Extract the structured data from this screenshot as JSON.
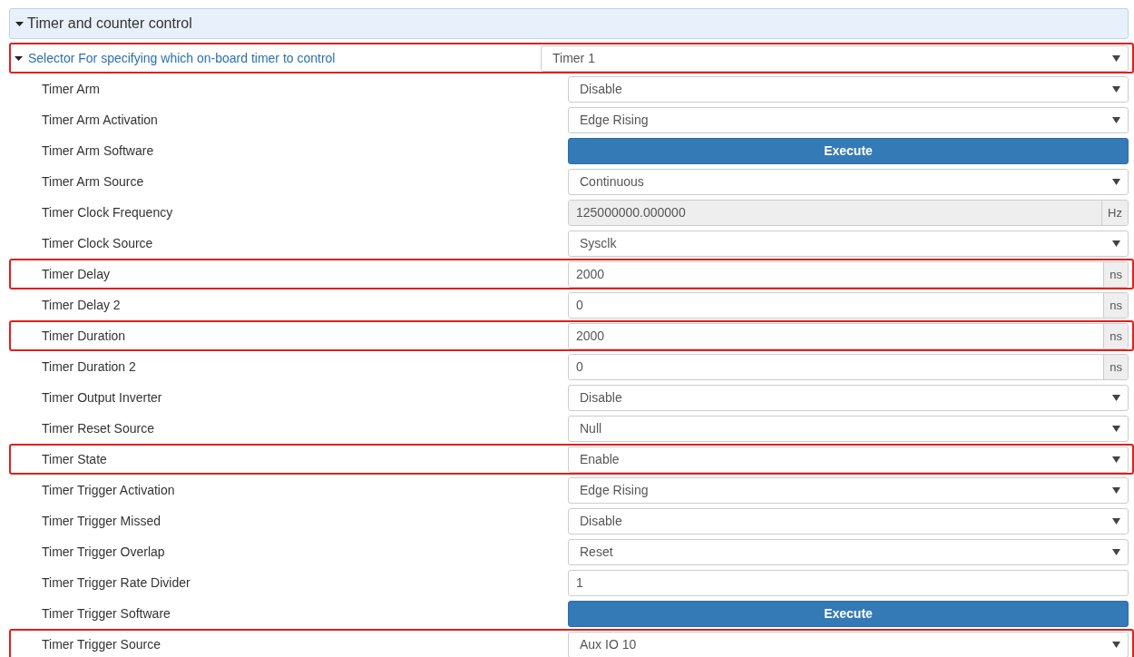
{
  "panel": {
    "title": "Timer and counter control",
    "expanded": true
  },
  "selector": {
    "label": "Selector For specifying which on-board timer to control",
    "expanded": true,
    "value": "Timer 1",
    "highlighted": true
  },
  "rows": [
    {
      "label": "Timer Arm",
      "kind": "select",
      "value": "Disable",
      "highlighted": false
    },
    {
      "label": "Timer Arm Activation",
      "kind": "select",
      "value": "Edge Rising",
      "highlighted": false
    },
    {
      "label": "Timer Arm Software",
      "kind": "button",
      "value": "Execute",
      "highlighted": false
    },
    {
      "label": "Timer Arm Source",
      "kind": "select",
      "value": "Continuous",
      "highlighted": false
    },
    {
      "label": "Timer Clock Frequency",
      "kind": "unit",
      "value": "125000000.000000",
      "unit": "Hz",
      "readonly": true,
      "highlighted": false
    },
    {
      "label": "Timer Clock Source",
      "kind": "select",
      "value": "Sysclk",
      "highlighted": false
    },
    {
      "label": "Timer Delay",
      "kind": "unit",
      "value": "2000",
      "unit": "ns",
      "readonly": false,
      "highlighted": true
    },
    {
      "label": "Timer Delay 2",
      "kind": "unit",
      "value": "0",
      "unit": "ns",
      "readonly": false,
      "highlighted": false
    },
    {
      "label": "Timer Duration",
      "kind": "unit",
      "value": "2000",
      "unit": "ns",
      "readonly": false,
      "highlighted": true
    },
    {
      "label": "Timer Duration 2",
      "kind": "unit",
      "value": "0",
      "unit": "ns",
      "readonly": false,
      "highlighted": false
    },
    {
      "label": "Timer Output Inverter",
      "kind": "select",
      "value": "Disable",
      "highlighted": false
    },
    {
      "label": "Timer Reset Source",
      "kind": "select",
      "value": "Null",
      "highlighted": false
    },
    {
      "label": "Timer State",
      "kind": "select",
      "value": "Enable",
      "highlighted": true
    },
    {
      "label": "Timer Trigger Activation",
      "kind": "select",
      "value": "Edge Rising",
      "highlighted": false
    },
    {
      "label": "Timer Trigger Missed",
      "kind": "select",
      "value": "Disable",
      "highlighted": false
    },
    {
      "label": "Timer Trigger Overlap",
      "kind": "select",
      "value": "Reset",
      "highlighted": false
    },
    {
      "label": "Timer Trigger Rate Divider",
      "kind": "text",
      "value": "1",
      "highlighted": false
    },
    {
      "label": "Timer Trigger Software",
      "kind": "button",
      "value": "Execute",
      "highlighted": false
    },
    {
      "label": "Timer Trigger Source",
      "kind": "select",
      "value": "Aux IO 10",
      "highlighted": true
    }
  ]
}
